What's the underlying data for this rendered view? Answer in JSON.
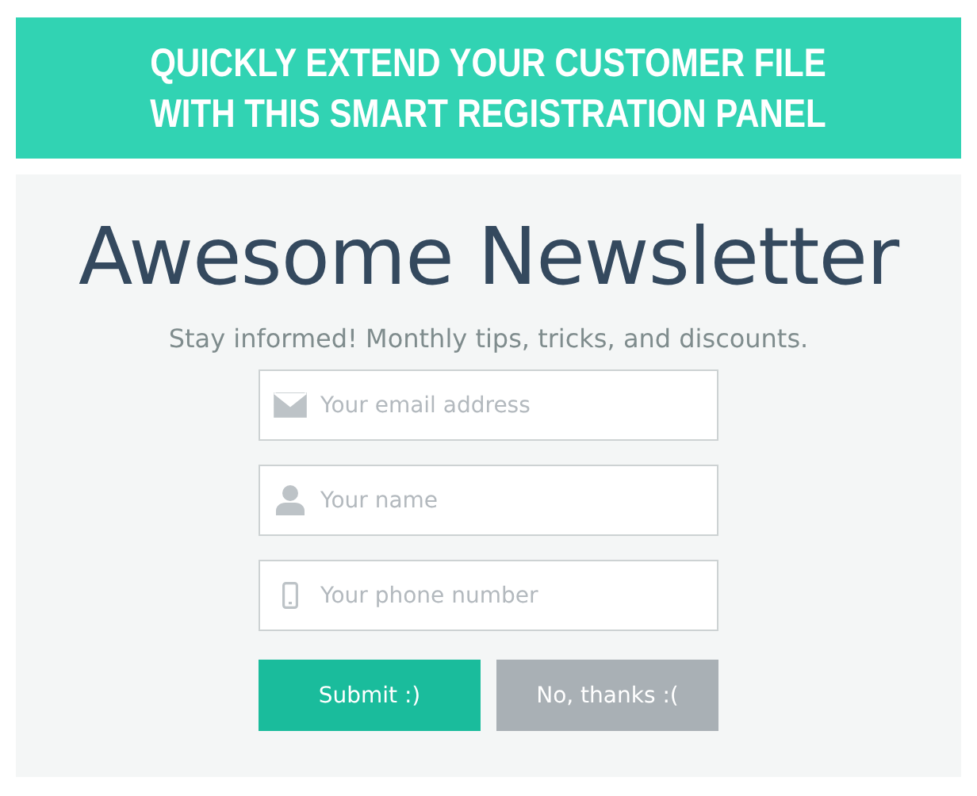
{
  "banner": {
    "lines": [
      "QUICKLY EXTEND YOUR CUSTOMER FILE",
      "WITH THIS SMART REGISTRATION PANEL"
    ]
  },
  "panel": {
    "title": "Awesome Newsletter",
    "subtitle": "Stay informed! Monthly tips, tricks, and discounts.",
    "fields": [
      {
        "kind": "email",
        "placeholder": "Your email address"
      },
      {
        "kind": "name",
        "placeholder": "Your name"
      },
      {
        "kind": "phone",
        "placeholder": "Your phone number"
      }
    ],
    "buttons": [
      {
        "kind": "primary",
        "label": "Submit :)"
      },
      {
        "kind": "secondary",
        "label": "No, thanks :("
      }
    ]
  }
}
